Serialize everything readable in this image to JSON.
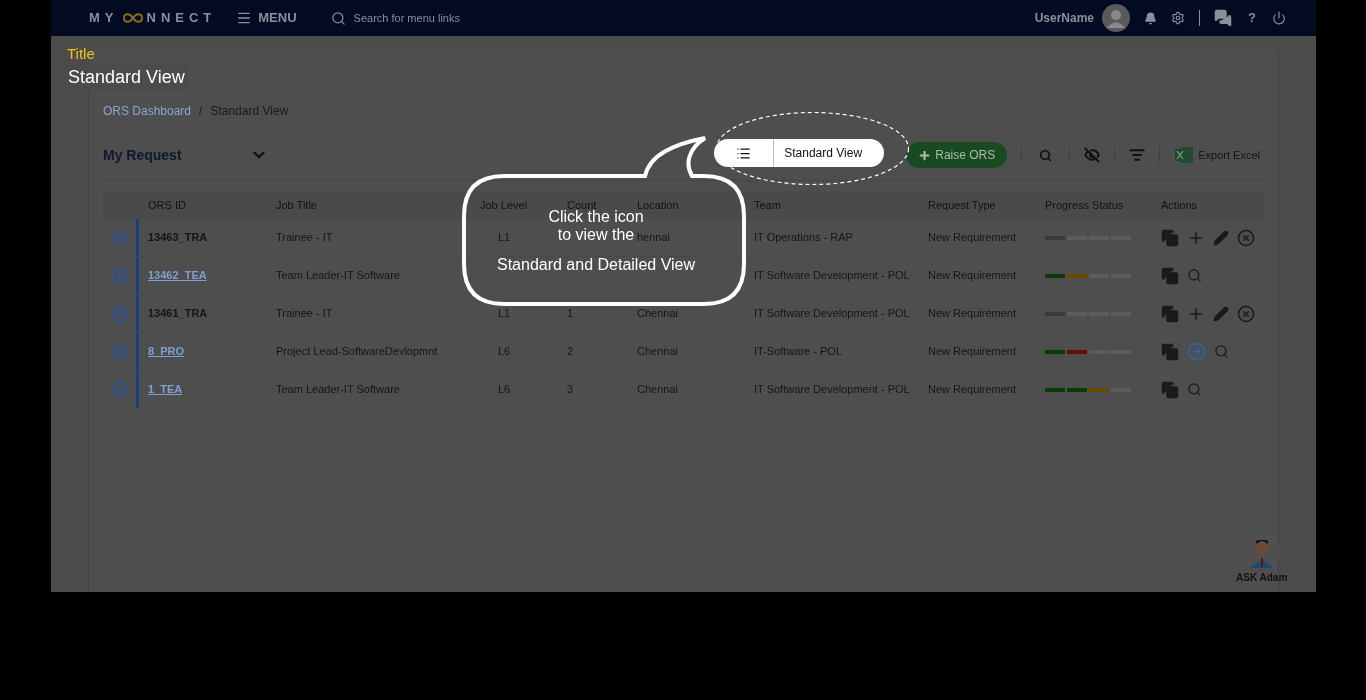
{
  "navbar": {
    "logo": {
      "left": "MY",
      "right": "NNECT"
    },
    "menu": "MENU",
    "search": {
      "placeholder": "Search for menu links"
    },
    "user": "UserName",
    "help": "?"
  },
  "breadcrumb": {
    "separator": "/",
    "items": [
      {
        "label": "ORS Dashboard",
        "link": true
      },
      {
        "label": "Standard View",
        "link": false
      }
    ]
  },
  "filter": {
    "value": "My Request"
  },
  "toolbar": {
    "view_toggle": {
      "label": "Standard View"
    },
    "raise_button": "Raise ORS",
    "export": "Export Excel"
  },
  "table": {
    "columns": [
      "ORS ID",
      "Job Title",
      "Job Level",
      "Count",
      "Location",
      "Team",
      "Request Type",
      "Progress Status",
      "Actions"
    ],
    "rows": [
      {
        "id": "13463_TRA",
        "link": false,
        "job_title": "Trainee - IT",
        "job_level": "L1",
        "location": "hennai",
        "team": "IT Operations - RAP",
        "request_type": "New Requirement",
        "progress": [
          {
            "color": "#3a3a3a"
          },
          {
            "color": "#5c5c5c"
          },
          {
            "color": "#5c5c5c"
          },
          {
            "color": "#5c5c5c"
          }
        ],
        "actions": [
          {
            "kind": "copy"
          },
          {
            "kind": "add"
          },
          {
            "kind": "edit"
          },
          {
            "kind": "cancel"
          }
        ]
      },
      {
        "id": "13462_TEA",
        "link": true,
        "job_title": "Team Leader-IT Software",
        "team": "IT Software Development - POL",
        "request_type": "New Requirement",
        "progress": [
          {
            "color": "#0a3a0a"
          },
          {
            "color": "#6a4800"
          },
          {
            "color": "#5c5c5c"
          },
          {
            "color": "#5c5c5c"
          }
        ],
        "actions": [
          {
            "kind": "copy"
          },
          {
            "kind": "search"
          }
        ]
      },
      {
        "id": "13461_TRA",
        "link": false,
        "job_title": "Trainee - IT",
        "job_level": "L1",
        "count": "1",
        "location": "Chennai",
        "team": "IT Software Development - POL",
        "request_type": "New Requirement",
        "progress": [
          {
            "color": "#3a3a3a"
          },
          {
            "color": "#5c5c5c"
          },
          {
            "color": "#5c5c5c"
          },
          {
            "color": "#5c5c5c"
          }
        ],
        "actions": [
          {
            "kind": "copy"
          },
          {
            "kind": "add"
          },
          {
            "kind": "edit"
          },
          {
            "kind": "cancel"
          }
        ]
      },
      {
        "id": "8_PRO",
        "link": true,
        "job_title": "Project Lead-SoftwareDevlopmnt",
        "job_level": "L6",
        "count": "2",
        "location": "Chennai",
        "team": "IT-Software - POL",
        "request_type": "New Requirement",
        "progress": [
          {
            "color": "#0a3a0a"
          },
          {
            "color": "#6a0a0a"
          },
          {
            "color": "#5c5c5c"
          },
          {
            "color": "#5c5c5c"
          }
        ],
        "actions": [
          {
            "kind": "copy"
          },
          {
            "kind": "forward"
          },
          {
            "kind": "search"
          }
        ]
      },
      {
        "id": "1_TEA",
        "link": true,
        "job_title": "Team Leader-IT Software",
        "job_level": "L6",
        "count": "3",
        "location": "Chennai",
        "team": "IT Software Development - POL",
        "request_type": "New Requirement",
        "progress": [
          {
            "color": "#0a3a0a"
          },
          {
            "color": "#0a3a0a"
          },
          {
            "color": "#6a4800"
          },
          {
            "color": "#5c5c5c"
          }
        ],
        "actions": [
          {
            "kind": "copy"
          },
          {
            "kind": "search"
          }
        ]
      }
    ]
  },
  "assistant": {
    "label": "ASK Adam"
  },
  "overlay": {
    "caption": "Title",
    "heading": "Standard View",
    "callout": [
      "Click the icon",
      "to view the",
      "Standard and Detailed View"
    ]
  }
}
